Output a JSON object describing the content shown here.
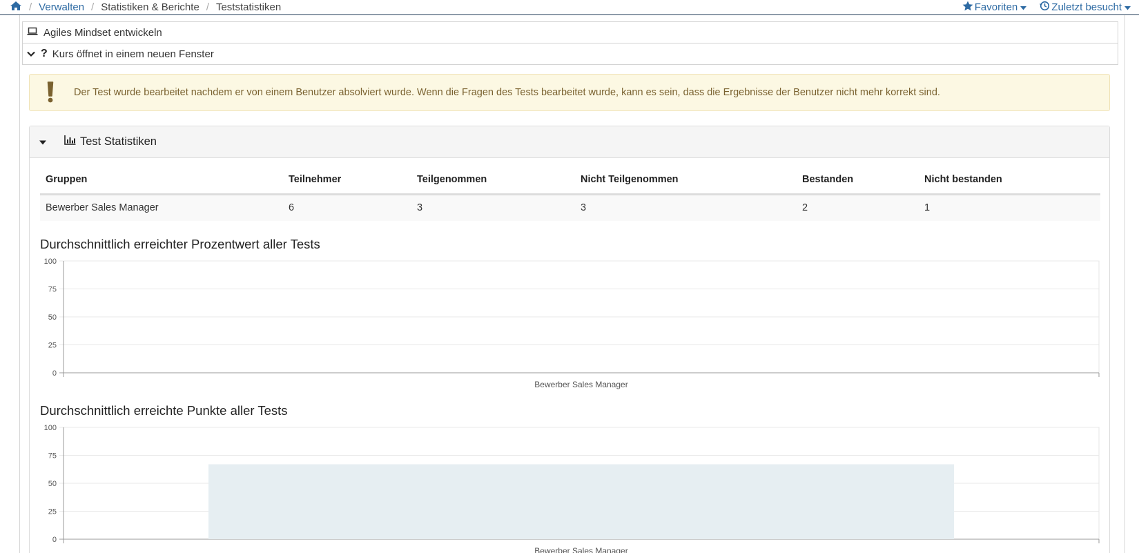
{
  "breadcrumb": {
    "items": [
      "Verwalten",
      "Statistiken & Berichte",
      "Teststatistiken"
    ]
  },
  "topnav": {
    "favorites": "Favoriten",
    "recent": "Zuletzt besucht"
  },
  "course": {
    "title": "Agiles Mindset entwickeln",
    "window_note": "Kurs öffnet in einem neuen Fenster"
  },
  "alert": {
    "text": "Der Test wurde bearbeitet nachdem er von einem Benutzer absolviert wurde. Wenn die Fragen des Tests bearbeitet wurde, kann es sein, dass die Ergebnisse der Benutzer nicht mehr korrekt sind."
  },
  "panel": {
    "title": "Test Statistiken"
  },
  "table": {
    "headers": [
      "Gruppen",
      "Teilnehmer",
      "Teilgenommen",
      "Nicht Teilgenommen",
      "Bestanden",
      "Nicht bestanden"
    ],
    "rows": [
      [
        "Bewerber Sales Manager",
        "6",
        "3",
        "3",
        "2",
        "1"
      ]
    ]
  },
  "colors": {
    "link": "#2d6aa3",
    "alert_bg": "#fcf8e3",
    "alert_text": "#7a6230",
    "bar": "#e6eef2"
  },
  "chart_data": [
    {
      "type": "bar",
      "title": "Durchschnittlich erreichter Prozentwert aller Tests",
      "categories": [
        "Bewerber Sales Manager"
      ],
      "values": [
        0
      ],
      "ylim": [
        0,
        100
      ],
      "yticks": [
        "100",
        "75",
        "50",
        "25",
        "0"
      ],
      "grid": true
    },
    {
      "type": "bar",
      "title": "Durchschnittlich erreichte Punkte aller Tests",
      "categories": [
        "Bewerber Sales Manager"
      ],
      "values": [
        67
      ],
      "ylim": [
        0,
        100
      ],
      "yticks": [
        "100",
        "75",
        "50",
        "25",
        "0"
      ],
      "grid": true
    }
  ]
}
